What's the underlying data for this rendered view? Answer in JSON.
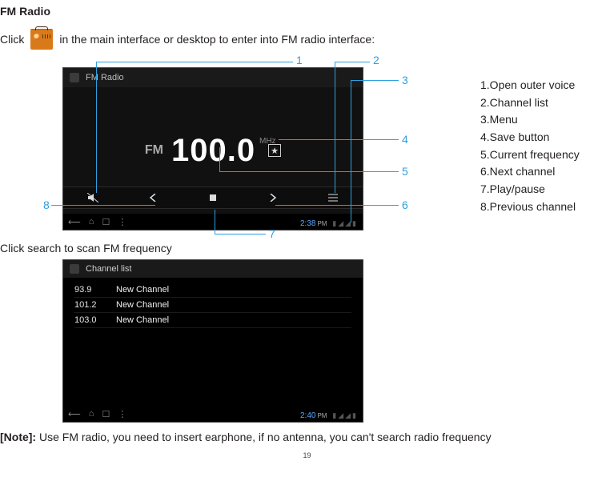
{
  "title": "FM Radio",
  "intro_pre": "Click",
  "intro_post": "in the main interface or desktop to enter into FM radio interface:",
  "fig1": {
    "app_title": "FM Radio",
    "fm_label": "FM",
    "frequency": "100.0",
    "mhz": "MHz",
    "status_time": "2:38",
    "status_ampm": "PM"
  },
  "callouts": {
    "n1": "1",
    "n2": "2",
    "n3": "3",
    "n4": "4",
    "n5": "5",
    "n6": "6",
    "n7": "7",
    "n8": "8"
  },
  "legend": {
    "i1": "1.Open outer voice",
    "i2": "2.Channel list",
    "i3": "3.Menu",
    "i4": "4.Save button",
    "i5": "5.Current frequency",
    "i6": "6.Next channel",
    "i7": "7.Play/pause",
    "i8": "8.Previous channel"
  },
  "scan_text": "Click search to scan FM frequency",
  "fig2": {
    "title": "Channel list",
    "items": [
      {
        "freq": "93.9",
        "name": "New Channel"
      },
      {
        "freq": "101.2",
        "name": "New Channel"
      },
      {
        "freq": "103.0",
        "name": "New Channel"
      }
    ],
    "status_time": "2:40",
    "status_ampm": "PM"
  },
  "note_label": "[Note]:",
  "note_text": " Use FM radio, you need to insert earphone, if no antenna, you can't search radio frequency",
  "page_number": "19"
}
